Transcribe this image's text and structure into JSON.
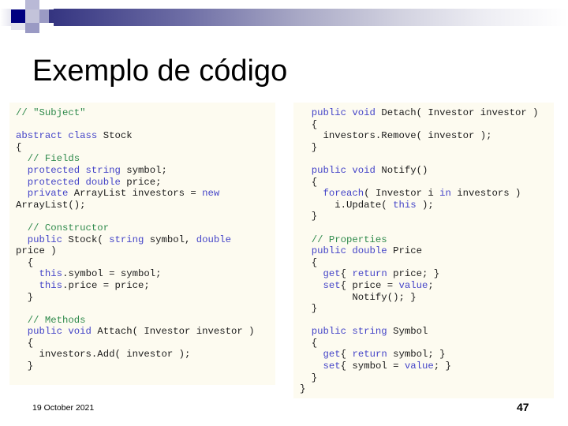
{
  "slide": {
    "title": "Exemplo de código",
    "footer_date": "19 October 2021",
    "page_number": "47"
  },
  "theme": {
    "banner_gradient_start": "#232372",
    "banner_gradient_end": "#ffffff",
    "accent_navy": "#000080",
    "accent_lavender": "#9a9ac4",
    "code_background": "#fdfbf0",
    "comment_color": "#2f8a4c",
    "keyword_color": "#4444c8",
    "identifier_color": "#1b1b1b",
    "page_background": "#ffffff"
  },
  "code_left": {
    "language": "csharp",
    "lines": [
      [
        {
          "t": "// \"Subject\"",
          "c": "cm"
        }
      ],
      [],
      [
        {
          "t": "abstract class ",
          "c": "kw"
        },
        {
          "t": "Stock",
          "c": "id"
        }
      ],
      [
        {
          "t": "{",
          "c": "id"
        }
      ],
      [
        {
          "t": "  // Fields",
          "c": "cm"
        }
      ],
      [
        {
          "t": "  protected string ",
          "c": "kw"
        },
        {
          "t": "symbol;",
          "c": "id"
        }
      ],
      [
        {
          "t": "  protected double ",
          "c": "kw"
        },
        {
          "t": "price;",
          "c": "id"
        }
      ],
      [
        {
          "t": "  private ",
          "c": "kw"
        },
        {
          "t": "ArrayList investors = ",
          "c": "id"
        },
        {
          "t": "new",
          "c": "kw"
        }
      ],
      [
        {
          "t": "ArrayList();",
          "c": "id"
        }
      ],
      [],
      [
        {
          "t": "  // Constructor",
          "c": "cm"
        }
      ],
      [
        {
          "t": "  public ",
          "c": "kw"
        },
        {
          "t": "Stock( ",
          "c": "id"
        },
        {
          "t": "string ",
          "c": "kw"
        },
        {
          "t": "symbol, ",
          "c": "id"
        },
        {
          "t": "double",
          "c": "kw"
        }
      ],
      [
        {
          "t": "price )",
          "c": "id"
        }
      ],
      [
        {
          "t": "  {",
          "c": "id"
        }
      ],
      [
        {
          "t": "    ",
          "c": "id"
        },
        {
          "t": "this",
          "c": "kw"
        },
        {
          "t": ".symbol = symbol;",
          "c": "id"
        }
      ],
      [
        {
          "t": "    ",
          "c": "id"
        },
        {
          "t": "this",
          "c": "kw"
        },
        {
          "t": ".price = price;",
          "c": "id"
        }
      ],
      [
        {
          "t": "  }",
          "c": "id"
        }
      ],
      [],
      [
        {
          "t": "  // Methods",
          "c": "cm"
        }
      ],
      [
        {
          "t": "  public void ",
          "c": "kw"
        },
        {
          "t": "Attach( Investor investor )",
          "c": "id"
        }
      ],
      [
        {
          "t": "  {",
          "c": "id"
        }
      ],
      [
        {
          "t": "    investors.Add( investor );",
          "c": "id"
        }
      ],
      [
        {
          "t": "  }",
          "c": "id"
        }
      ]
    ]
  },
  "code_right": {
    "language": "csharp",
    "lines": [
      [
        {
          "t": "  public void ",
          "c": "kw"
        },
        {
          "t": "Detach( Investor investor )",
          "c": "id"
        }
      ],
      [
        {
          "t": "  {",
          "c": "id"
        }
      ],
      [
        {
          "t": "    investors.Remove( investor );",
          "c": "id"
        }
      ],
      [
        {
          "t": "  }",
          "c": "id"
        }
      ],
      [],
      [
        {
          "t": "  public void ",
          "c": "kw"
        },
        {
          "t": "Notify()",
          "c": "id"
        }
      ],
      [
        {
          "t": "  {",
          "c": "id"
        }
      ],
      [
        {
          "t": "    ",
          "c": "id"
        },
        {
          "t": "foreach",
          "c": "kw"
        },
        {
          "t": "( Investor i ",
          "c": "id"
        },
        {
          "t": "in ",
          "c": "kw"
        },
        {
          "t": "investors )",
          "c": "id"
        }
      ],
      [
        {
          "t": "      i.Update( ",
          "c": "id"
        },
        {
          "t": "this",
          "c": "kw"
        },
        {
          "t": " );",
          "c": "id"
        }
      ],
      [
        {
          "t": "  }",
          "c": "id"
        }
      ],
      [],
      [
        {
          "t": "  // Properties",
          "c": "cm"
        }
      ],
      [
        {
          "t": "  public double ",
          "c": "kw"
        },
        {
          "t": "Price",
          "c": "id"
        }
      ],
      [
        {
          "t": "  {",
          "c": "id"
        }
      ],
      [
        {
          "t": "    ",
          "c": "id"
        },
        {
          "t": "get",
          "c": "kw"
        },
        {
          "t": "{ ",
          "c": "id"
        },
        {
          "t": "return ",
          "c": "kw"
        },
        {
          "t": "price; }",
          "c": "id"
        }
      ],
      [
        {
          "t": "    ",
          "c": "id"
        },
        {
          "t": "set",
          "c": "kw"
        },
        {
          "t": "{ price = ",
          "c": "id"
        },
        {
          "t": "value",
          "c": "kw"
        },
        {
          "t": ";",
          "c": "id"
        }
      ],
      [
        {
          "t": "         Notify(); }",
          "c": "id"
        }
      ],
      [
        {
          "t": "  }",
          "c": "id"
        }
      ],
      [],
      [
        {
          "t": "  public string ",
          "c": "kw"
        },
        {
          "t": "Symbol",
          "c": "id"
        }
      ],
      [
        {
          "t": "  {",
          "c": "id"
        }
      ],
      [
        {
          "t": "    ",
          "c": "id"
        },
        {
          "t": "get",
          "c": "kw"
        },
        {
          "t": "{ ",
          "c": "id"
        },
        {
          "t": "return ",
          "c": "kw"
        },
        {
          "t": "symbol; }",
          "c": "id"
        }
      ],
      [
        {
          "t": "    ",
          "c": "id"
        },
        {
          "t": "set",
          "c": "kw"
        },
        {
          "t": "{ symbol = ",
          "c": "id"
        },
        {
          "t": "value",
          "c": "kw"
        },
        {
          "t": "; }",
          "c": "id"
        }
      ],
      [
        {
          "t": "  }",
          "c": "id"
        }
      ],
      [
        {
          "t": "}",
          "c": "id"
        }
      ]
    ]
  }
}
